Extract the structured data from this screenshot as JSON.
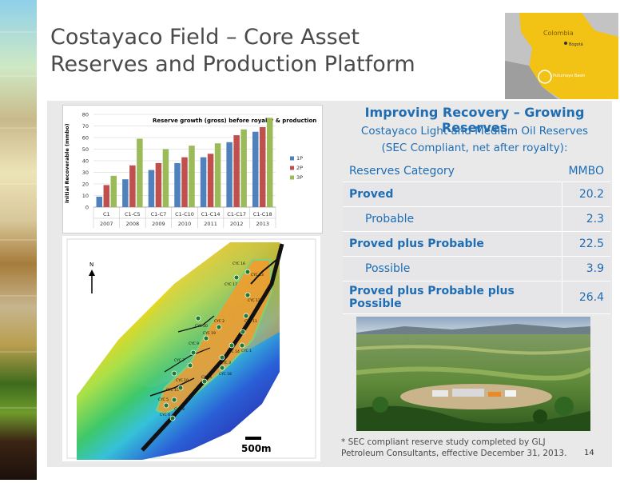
{
  "slide": {
    "title_line1": "Costayaco Field – Core Asset",
    "title_line2": "Reserves and Production Platform",
    "page_number": "14"
  },
  "map_inset": {
    "country_label": "Colombia",
    "city_label": "Bogotá",
    "basin_label": "Putumayo Basin"
  },
  "chart_data": {
    "type": "bar",
    "title": "Reserve growth (gross) before royalty & production",
    "ylabel": "Initial Recoverable (mmbo)",
    "ylim": [
      0,
      80
    ],
    "yticks": [
      "0",
      "10",
      "20",
      "30",
      "40",
      "50",
      "60",
      "70",
      "80"
    ],
    "categories": [
      "C1",
      "C1-C5",
      "C1-C7",
      "C1-C10",
      "C1-C14",
      "C1-C17",
      "C1-C18"
    ],
    "years": [
      "2007",
      "2008",
      "2009",
      "2010",
      "2011",
      "2012",
      "2013"
    ],
    "series": [
      {
        "name": "1P",
        "color": "#4f81bd",
        "values": [
          9,
          24,
          32,
          38,
          43,
          56,
          65
        ]
      },
      {
        "name": "2P",
        "color": "#c0504d",
        "values": [
          19,
          36,
          38,
          43,
          46,
          62,
          69
        ]
      },
      {
        "name": "3P",
        "color": "#9bbb59",
        "values": [
          27,
          59,
          50,
          53,
          55,
          67,
          77
        ]
      }
    ],
    "legend_position": "right"
  },
  "contour_map": {
    "north_label": "N",
    "scale_label": "500m",
    "wells": [
      "CYC 17",
      "CYC 13",
      "CYC 16",
      "CYC 12",
      "CYC 11",
      "CYC 1",
      "CYC 14",
      "CYC 2",
      "CYC 19",
      "CYC 3",
      "CYC 18",
      "CYC 9",
      "CYC 7",
      "CYC 4",
      "CYC 10",
      "CYC 15",
      "CYC 5",
      "CYC 8",
      "CYC 6",
      "CYC 20"
    ]
  },
  "reserves": {
    "heading": "Improving Recovery – Growing Reserves",
    "subtitle_line1": "Costayaco Light and Medium Oil Reserves",
    "subtitle_line2": "(SEC Compliant, net after royalty):",
    "col_category": "Reserves Category",
    "col_value": "MMBO",
    "rows": [
      {
        "label": "Proved",
        "value": "20.2",
        "bold": true,
        "indent": false
      },
      {
        "label": "Probable",
        "value": "2.3",
        "bold": false,
        "indent": true
      },
      {
        "label": "Proved plus Probable",
        "value": "22.5",
        "bold": true,
        "indent": false
      },
      {
        "label": "Possible",
        "value": "3.9",
        "bold": false,
        "indent": true
      },
      {
        "label": "Proved plus Probable plus Possible",
        "value": "26.4",
        "bold": true,
        "indent": false
      }
    ]
  },
  "footnote": "* SEC compliant reserve study completed by GLJ Petroleum Consultants, effective December 31, 2013."
}
